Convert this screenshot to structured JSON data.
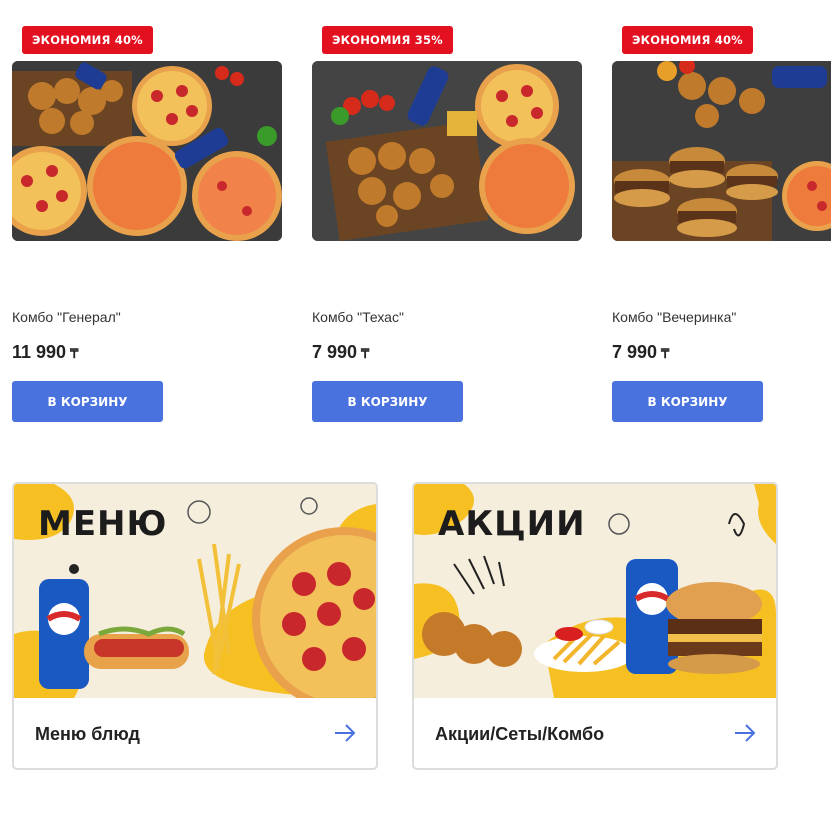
{
  "products": [
    {
      "badge": "ЭКОНОМИЯ 40%",
      "name": "Комбо \"Генерал\"",
      "price": "11 990",
      "currency": "₸",
      "button": "В КОРЗИНУ"
    },
    {
      "badge": "ЭКОНОМИЯ 35%",
      "name": "Комбо \"Техас\"",
      "price": "7 990",
      "currency": "₸",
      "button": "В КОРЗИНУ"
    },
    {
      "badge": "ЭКОНОМИЯ 40%",
      "name": "Комбо \"Вечеринка\"",
      "price": "7 990",
      "currency": "₸",
      "button": "В КОРЗИНУ"
    }
  ],
  "categories": [
    {
      "banner_title": "МЕНЮ",
      "label": "Меню блюд",
      "icon": "arrow-right-icon"
    },
    {
      "banner_title": "АКЦИИ",
      "label": "Акции/Сеты/Комбо",
      "icon": "arrow-right-icon"
    }
  ],
  "colors": {
    "badge": "#e3101f",
    "button": "#4a72df",
    "banner_accent": "#f6c022"
  }
}
